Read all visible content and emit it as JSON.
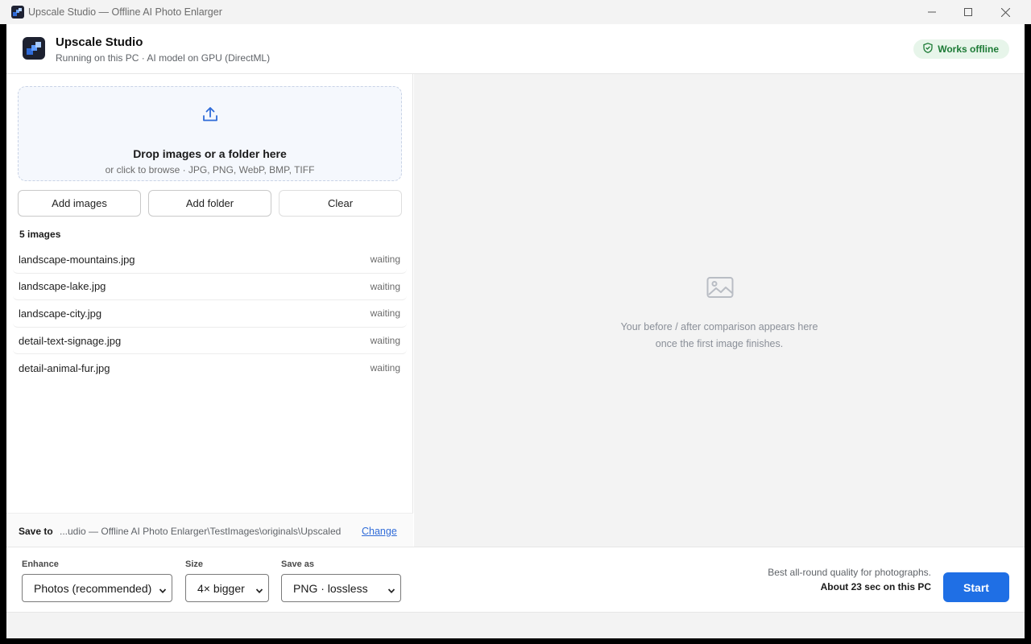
{
  "window": {
    "title": "Upscale Studio — Offline AI Photo Enlarger",
    "controls": [
      "minimize-icon",
      "maximize-icon",
      "close-icon"
    ]
  },
  "header": {
    "app_name": "Upscale Studio",
    "subtitle": "Running on this PC · AI model on GPU (DirectML)",
    "badge": "Works offline",
    "badge_icon": "shield-check-icon"
  },
  "dropzone": {
    "icon": "upload-icon",
    "title": "Drop images or a folder here",
    "subtitle": "or click to browse · JPG, PNG, WebP, BMP, TIFF"
  },
  "actions": {
    "add_images": "Add images",
    "add_folder": "Add folder",
    "clear": "Clear"
  },
  "queue": {
    "count_label": "5 images",
    "files": [
      {
        "name": "landscape-mountains.jpg",
        "status": "waiting"
      },
      {
        "name": "landscape-lake.jpg",
        "status": "waiting"
      },
      {
        "name": "landscape-city.jpg",
        "status": "waiting"
      },
      {
        "name": "detail-text-signage.jpg",
        "status": "waiting"
      },
      {
        "name": "detail-animal-fur.jpg",
        "status": "waiting"
      }
    ]
  },
  "save_to": {
    "label": "Save to",
    "path": "...udio — Offline AI Photo Enlarger\\TestImages\\originals\\Upscaled",
    "change": "Change"
  },
  "preview": {
    "icon": "image-icon",
    "line1": "Your before / after comparison appears here",
    "line2": "once the first image finishes."
  },
  "settings": {
    "enhance_label": "Enhance",
    "enhance_value": "Photos (recommended)",
    "size_label": "Size",
    "size_value": "4× bigger",
    "save_as_label": "Save as",
    "save_as_value": "PNG · lossless"
  },
  "estimate": {
    "description": "Best all-round quality for photographs.",
    "time": "About 23 sec on this PC"
  },
  "start_label": "Start",
  "colors": {
    "accent": "#1f6fe5",
    "offline_badge_bg": "#e7f5ea",
    "offline_badge_text": "#1c7a35",
    "link": "#2f6bd8"
  }
}
